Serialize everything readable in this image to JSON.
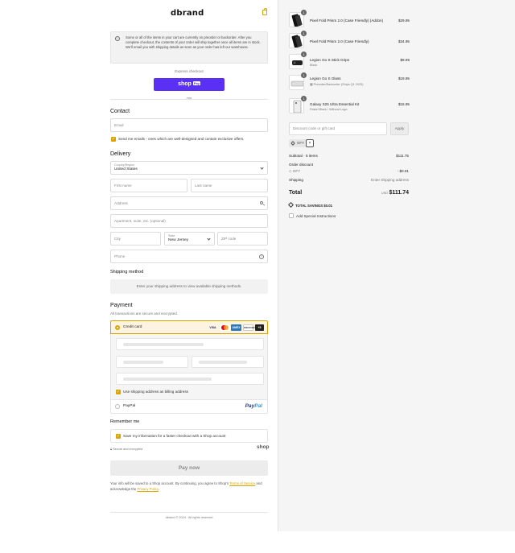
{
  "header": {
    "logo": "dbrand",
    "cart_icon": "bag-icon"
  },
  "notice": {
    "text": "Some or all of the items in your cart are currently on preorder or backorder. After you complete checkout, the contents of your order will ship together once all items are in stock. We'll email you with shipping details as soon as your order has left our warehouse."
  },
  "express": {
    "label": "Express checkout",
    "shop_pay_label": "shop",
    "shop_pay_badge": "Pay",
    "or_label": "OR"
  },
  "contact": {
    "title": "Contact",
    "email_placeholder": "Email",
    "newsletter_label": "Send me emails - ones which are well-designed and contain exclusive offers.",
    "newsletter_checked": true
  },
  "delivery": {
    "title": "Delivery",
    "country_label": "Country/Region",
    "country_value": "United States",
    "first_name_placeholder": "First name",
    "last_name_placeholder": "Last name",
    "address_placeholder": "Address",
    "apartment_placeholder": "Apartment, suite, etc. (optional)",
    "city_placeholder": "City",
    "state_label": "State",
    "state_value": "New Jersey",
    "zip_placeholder": "ZIP code",
    "phone_placeholder": "Phone"
  },
  "shipping_method": {
    "title": "Shipping method",
    "message": "Enter your shipping address to view available shipping methods."
  },
  "payment": {
    "title": "Payment",
    "subtitle": "All transactions are secure and encrypted.",
    "credit_card_label": "Credit card",
    "brands": [
      "VISA",
      "MC",
      "AMEX",
      "DISCOVER",
      "+5"
    ],
    "billing_same_label": "Use shipping address as billing address",
    "billing_same_checked": true,
    "paypal_label": "PayPal",
    "paypal_logo_a": "Pay",
    "paypal_logo_b": "Pal"
  },
  "remember": {
    "title": "Remember me",
    "save_label": "Save my information for a faster checkout with a Shop account",
    "save_checked": true,
    "secure_label": "Secure and encrypted",
    "shop_logo": "shop"
  },
  "pay_now_label": "Pay now",
  "legal": {
    "text_before": "Your info will be saved to a Shop account. By continuing, you agree to Shop's ",
    "terms_link": "Terms of Service",
    "text_middle": " and acknowledge the ",
    "privacy_link": "Privacy Policy",
    "text_after": "."
  },
  "footer": "dbrand © 2024  ·  All rights reserved",
  "order": {
    "items": [
      {
        "name": "Pixel Fold Prism 2.0 (Case Friendly) (Addon)",
        "variant": "",
        "price": "$29.95",
        "qty": "1"
      },
      {
        "name": "Pixel Fold Prism 2.0 (Case Friendly)",
        "variant": "",
        "price": "$34.95",
        "qty": "1"
      },
      {
        "name": "Legion Go S Stick Grips",
        "variant": "Black",
        "price": "$9.95",
        "qty": "1"
      },
      {
        "name": "Legion Go S Glass",
        "variant": "Preorder/Backorder (Ships Q1 2025)",
        "price": "$19.95",
        "qty": "1"
      },
      {
        "name": "Galaxy S25 Ultra Essential Kit",
        "variant": "Pastel Black / Without Logo",
        "price": "$16.95",
        "qty": "1"
      }
    ],
    "discount_placeholder": "Discount code or gift card",
    "apply_label": "Apply",
    "applied_code": "GFY",
    "remove_code": "×",
    "subtotal_label": "Subtotal · 5 items",
    "subtotal_value": "$111.75",
    "order_discount_label": "Order discount",
    "discount_code_label": "GFY",
    "discount_value": "- $0.01",
    "shipping_label": "Shipping",
    "shipping_value": "Enter shipping address",
    "total_label": "Total",
    "currency": "USD",
    "total_value": "$111.74",
    "savings_label": "TOTAL SAVINGS",
    "savings_value": "$0.01",
    "special_instructions_label": "Add Special Instructions"
  },
  "colors": {
    "accent": "#d9a400",
    "shop_pay": "#5a31f4",
    "sidebar_bg": "#f5f5f5"
  }
}
